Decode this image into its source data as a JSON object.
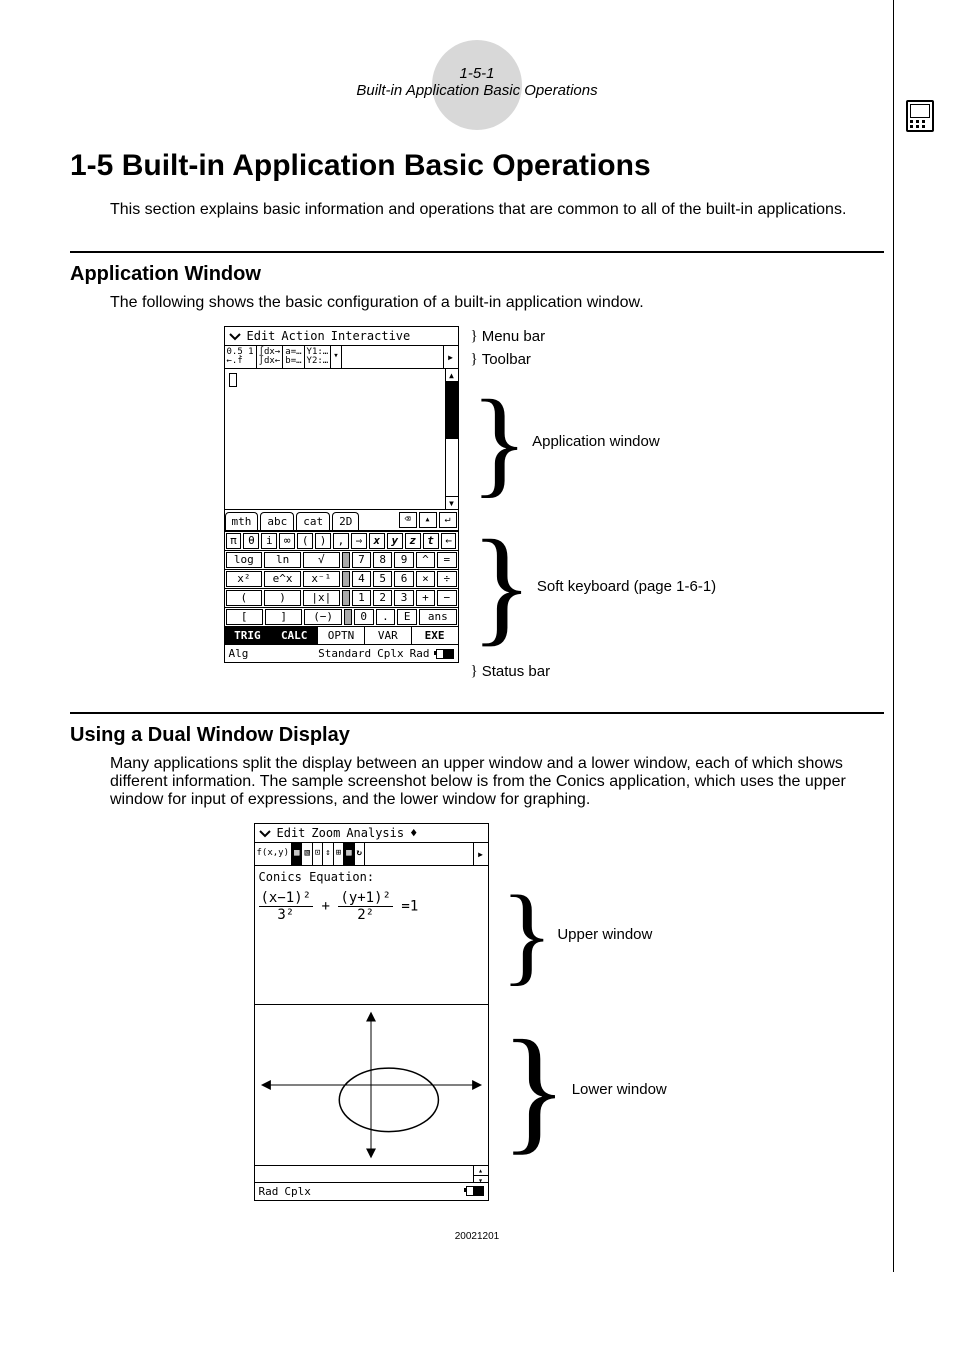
{
  "header": {
    "page_number": "1-5-1",
    "page_title": "Built-in Application Basic Operations"
  },
  "section": {
    "number": "1-5",
    "title": "Built-in Application Basic Operations",
    "intro": "This section explains basic information and operations that are common to all of the built-in applications."
  },
  "subsection1": {
    "title": "Application Window",
    "intro": "The following shows the basic configuration of a built-in application window.",
    "annotations": {
      "menubar": "Menu bar",
      "toolbar": "Toolbar",
      "appwin": "Application window",
      "softkbd": "Soft keyboard (page 1-6-1)",
      "statusbar": "Status bar"
    },
    "calc": {
      "menus": [
        "Edit",
        "Action",
        "Interactive"
      ],
      "tabs": [
        "mth",
        "abc",
        "cat",
        "2D"
      ],
      "row1": [
        "π",
        "θ",
        "i",
        "∞",
        "(",
        ")",
        ",",
        "⇒",
        "x",
        "y",
        "z",
        "t",
        "←"
      ],
      "row2_left": [
        "log",
        "ln",
        "√"
      ],
      "row2_right": [
        "7",
        "8",
        "9",
        "^",
        "="
      ],
      "row3_left": [
        "x²",
        "e^x",
        "x⁻¹"
      ],
      "row3_right": [
        "4",
        "5",
        "6",
        "×",
        "÷"
      ],
      "row4_left": [
        "(",
        ")",
        "|x|"
      ],
      "row4_right": [
        "1",
        "2",
        "3",
        "+",
        "−"
      ],
      "row5_left": [
        "[",
        "]",
        "(−)"
      ],
      "row5_right": [
        "0",
        ".",
        "E",
        "ans"
      ],
      "bottom": [
        "TRIG",
        "CALC",
        "OPTN",
        "VAR",
        "EXE"
      ],
      "status": [
        "Alg",
        "Standard",
        "Cplx",
        "Rad"
      ]
    }
  },
  "subsection2": {
    "title": "Using a Dual Window Display",
    "intro": "Many applications split the display between an upper window and a lower window, each of which shows different information. The sample screenshot below is from the Conics application, which uses the upper window for input of expressions, and the lower window for graphing.",
    "annotations": {
      "upper": "Upper window",
      "lower": "Lower window"
    },
    "conics": {
      "menus": [
        "Edit",
        "Zoom",
        "Analysis",
        "♦"
      ],
      "label": "Conics Equation:",
      "equation_parts": {
        "num1": "(x−1)²",
        "den1": "3²",
        "num2": "(y+1)²",
        "den2": "2²",
        "rhs": "=1"
      },
      "status": [
        "Rad",
        "Cplx"
      ]
    }
  },
  "date_stamp": "20021201"
}
